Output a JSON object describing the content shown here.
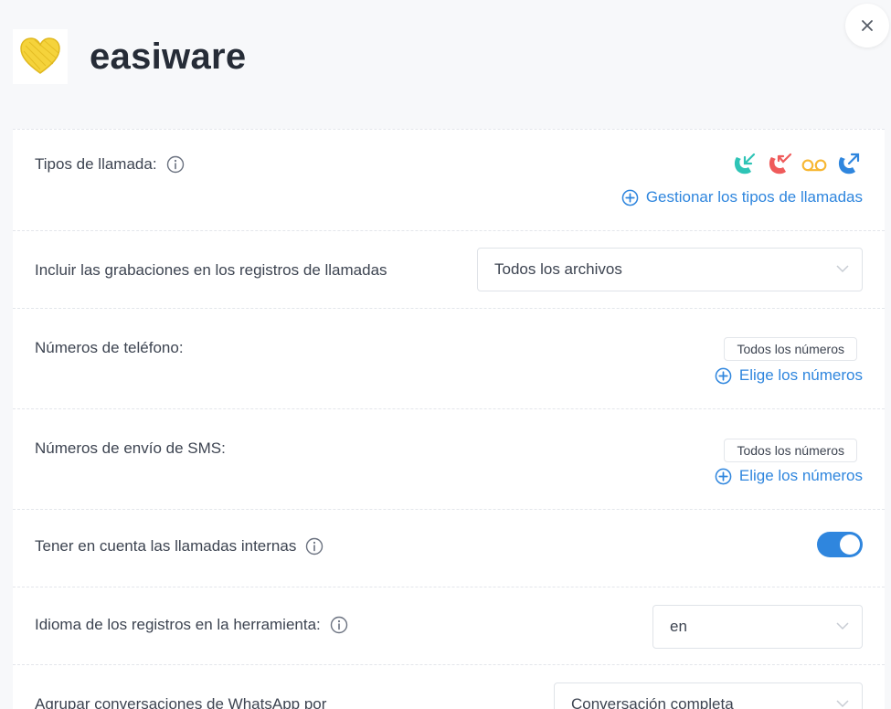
{
  "header": {
    "brand_name": "easiware",
    "logo_icon": "heart-scribble-icon",
    "close_icon": "close-icon"
  },
  "colors": {
    "accent": "#2f86de",
    "incoming_call": "#2ec4b6",
    "missed_call": "#ef5b5b",
    "voicemail": "#f7b733",
    "outgoing_call": "#2f86de",
    "logo_yellow": "#f5d33b"
  },
  "settings": {
    "call_types": {
      "label": "Tipos de llamada:",
      "icons": [
        "incoming-call-icon",
        "missed-call-icon",
        "voicemail-icon",
        "outgoing-call-icon"
      ],
      "manage_link": "Gestionar los tipos de llamadas"
    },
    "recordings": {
      "label": "Incluir las grabaciones en los registros de llamadas",
      "selected": "Todos los archivos"
    },
    "phone_numbers": {
      "label": "Números de teléfono:",
      "chip": "Todos los números",
      "choose_link": "Elige los números"
    },
    "sms_numbers": {
      "label": "Números de envío de SMS:",
      "chip": "Todos los números",
      "choose_link": "Elige los números"
    },
    "internal_calls": {
      "label": "Tener en cuenta las llamadas internas",
      "enabled": true
    },
    "language": {
      "label": "Idioma de los registros en la herramienta:",
      "selected": "en"
    },
    "whatsapp_grouping": {
      "label": "Agrupar conversaciones de WhatsApp por",
      "selected": "Conversación completa"
    }
  }
}
